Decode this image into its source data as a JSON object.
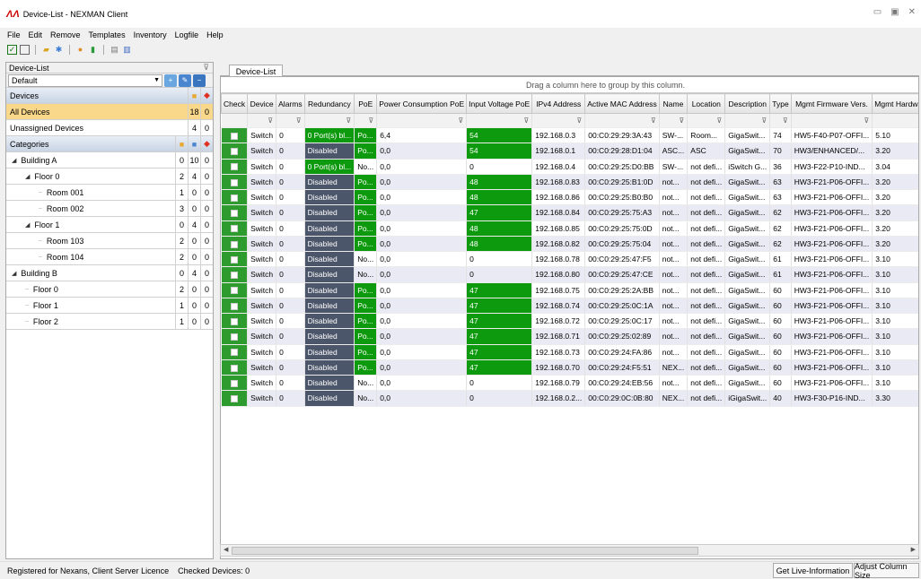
{
  "window": {
    "title": "Device-List - NEXMAN Client",
    "logo": "ɅɅ"
  },
  "menu": [
    "File",
    "Edit",
    "Remove",
    "Templates",
    "Inventory",
    "Logfile",
    "Help"
  ],
  "toolbar_icons": [
    "check-all-icon",
    "uncheck-icon",
    "folder-icon",
    "wand-icon",
    "user-icon",
    "database-icon",
    "template-icon",
    "template-edit-icon"
  ],
  "left": {
    "title": "Device-List",
    "pin": "⊽",
    "profile": "Default",
    "devices_header": "Devices",
    "device_rows": [
      {
        "name": "All Devices",
        "a": "18",
        "b": "0"
      },
      {
        "name": "Unassigned Devices",
        "a": "4",
        "b": "0"
      }
    ],
    "categories_header": "Categories",
    "tree": [
      {
        "name": "Building A",
        "lvl": 0,
        "exp": true,
        "a": "0",
        "b": "10",
        "c": "0"
      },
      {
        "name": "Floor 0",
        "lvl": 1,
        "exp": true,
        "a": "2",
        "b": "4",
        "c": "0"
      },
      {
        "name": "Room 001",
        "lvl": 2,
        "a": "1",
        "b": "0",
        "c": "0"
      },
      {
        "name": "Room 002",
        "lvl": 2,
        "a": "3",
        "b": "0",
        "c": "0"
      },
      {
        "name": "Floor 1",
        "lvl": 1,
        "exp": true,
        "a": "0",
        "b": "4",
        "c": "0"
      },
      {
        "name": "Room 103",
        "lvl": 2,
        "a": "2",
        "b": "0",
        "c": "0"
      },
      {
        "name": "Room 104",
        "lvl": 2,
        "a": "2",
        "b": "0",
        "c": "0"
      },
      {
        "name": "Building B",
        "lvl": 0,
        "exp": true,
        "a": "0",
        "b": "4",
        "c": "0"
      },
      {
        "name": "Floor 0",
        "lvl": 1,
        "a": "2",
        "b": "0",
        "c": "0"
      },
      {
        "name": "Floor 1",
        "lvl": 1,
        "a": "1",
        "b": "0",
        "c": "0"
      },
      {
        "name": "Floor 2",
        "lvl": 1,
        "a": "1",
        "b": "0",
        "c": "0"
      }
    ]
  },
  "tab": "Device-List",
  "group_hint": "Drag a column here to group by this column.",
  "columns": [
    "Check",
    "Device",
    "Alarms",
    "Redundancy",
    "PoE",
    "Power Consumption PoE",
    "Input Voltage PoE",
    "IPv4 Address",
    "Active MAC Address",
    "Name",
    "Location",
    "Description",
    "Type",
    "Mgmt Firmware Vers.",
    "Mgmt Hardware Vers."
  ],
  "rows": [
    [
      "",
      "Switch",
      "0",
      "0 Port(s) bl...",
      "Po...",
      "6,4",
      "54",
      "192.168.0.3",
      "00:C0:29:29:3A:43",
      "SW-...",
      "Room...",
      "GigaSwit...",
      "74",
      "HW5-F40-P07-OFFI...",
      "5.10"
    ],
    [
      "",
      "Switch",
      "0",
      "Disabled",
      "Po...",
      "0,0",
      "54",
      "192.168.0.1",
      "00:C0:29:28:D1:04",
      "ASC...",
      "ASC",
      "GigaSwit...",
      "70",
      "HW3/ENHANCED/...",
      "3.20"
    ],
    [
      "",
      "Switch",
      "0",
      "0 Port(s) bl...",
      "No...",
      "0,0",
      "0",
      "192.168.0.4",
      "00:C0:29:25:D0:BB",
      "SW-...",
      "not defi...",
      "iSwitch G...",
      "36",
      "HW3-F22-P10-IND...",
      "3.04"
    ],
    [
      "",
      "Switch",
      "0",
      "Disabled",
      "Po...",
      "0,0",
      "48",
      "192.168.0.83",
      "00:C0:29:25:B1:0D",
      "not...",
      "not defi...",
      "GigaSwit...",
      "63",
      "HW3-F21-P06-OFFI...",
      "3.20"
    ],
    [
      "",
      "Switch",
      "0",
      "Disabled",
      "Po...",
      "0,0",
      "48",
      "192.168.0.86",
      "00:C0:29:25:B0:B0",
      "not...",
      "not defi...",
      "GigaSwit...",
      "63",
      "HW3-F21-P06-OFFI...",
      "3.20"
    ],
    [
      "",
      "Switch",
      "0",
      "Disabled",
      "Po...",
      "0,0",
      "47",
      "192.168.0.84",
      "00:C0:29:25:75:A3",
      "not...",
      "not defi...",
      "GigaSwit...",
      "62",
      "HW3-F21-P06-OFFI...",
      "3.20"
    ],
    [
      "",
      "Switch",
      "0",
      "Disabled",
      "Po...",
      "0,0",
      "48",
      "192.168.0.85",
      "00:C0:29:25:75:0D",
      "not...",
      "not defi...",
      "GigaSwit...",
      "62",
      "HW3-F21-P06-OFFI...",
      "3.20"
    ],
    [
      "",
      "Switch",
      "0",
      "Disabled",
      "Po...",
      "0,0",
      "48",
      "192.168.0.82",
      "00:C0:29:25:75:04",
      "not...",
      "not defi...",
      "GigaSwit...",
      "62",
      "HW3-F21-P06-OFFI...",
      "3.20"
    ],
    [
      "",
      "Switch",
      "0",
      "Disabled",
      "No...",
      "0,0",
      "0",
      "192.168.0.78",
      "00:C0:29:25:47:F5",
      "not...",
      "not defi...",
      "GigaSwit...",
      "61",
      "HW3-F21-P06-OFFI...",
      "3.10"
    ],
    [
      "",
      "Switch",
      "0",
      "Disabled",
      "No...",
      "0,0",
      "0",
      "192.168.0.80",
      "00:C0:29:25:47:CE",
      "not...",
      "not defi...",
      "GigaSwit...",
      "61",
      "HW3-F21-P06-OFFI...",
      "3.10"
    ],
    [
      "",
      "Switch",
      "0",
      "Disabled",
      "Po...",
      "0,0",
      "47",
      "192.168.0.75",
      "00:C0:29:25:2A:BB",
      "not...",
      "not defi...",
      "GigaSwit...",
      "60",
      "HW3-F21-P06-OFFI...",
      "3.10"
    ],
    [
      "",
      "Switch",
      "0",
      "Disabled",
      "Po...",
      "0,0",
      "47",
      "192.168.0.74",
      "00:C0:29:25:0C:1A",
      "not...",
      "not defi...",
      "GigaSwit...",
      "60",
      "HW3-F21-P06-OFFI...",
      "3.10"
    ],
    [
      "",
      "Switch",
      "0",
      "Disabled",
      "Po...",
      "0,0",
      "47",
      "192.168.0.72",
      "00:C0:29:25:0C:17",
      "not...",
      "not defi...",
      "GigaSwit...",
      "60",
      "HW3-F21-P06-OFFI...",
      "3.10"
    ],
    [
      "",
      "Switch",
      "0",
      "Disabled",
      "Po...",
      "0,0",
      "47",
      "192.168.0.71",
      "00:C0:29:25:02:89",
      "not...",
      "not defi...",
      "GigaSwit...",
      "60",
      "HW3-F21-P06-OFFI...",
      "3.10"
    ],
    [
      "",
      "Switch",
      "0",
      "Disabled",
      "Po...",
      "0,0",
      "47",
      "192.168.0.73",
      "00:C0:29:24:FA:86",
      "not...",
      "not defi...",
      "GigaSwit...",
      "60",
      "HW3-F21-P06-OFFI...",
      "3.10"
    ],
    [
      "",
      "Switch",
      "0",
      "Disabled",
      "Po...",
      "0,0",
      "47",
      "192.168.0.70",
      "00:C0:29:24:F5:51",
      "NEX...",
      "not defi...",
      "GigaSwit...",
      "60",
      "HW3-F21-P06-OFFI...",
      "3.10"
    ],
    [
      "",
      "Switch",
      "0",
      "Disabled",
      "No...",
      "0,0",
      "0",
      "192.168.0.79",
      "00:C0:29:24:EB:56",
      "not...",
      "not defi...",
      "GigaSwit...",
      "60",
      "HW3-F21-P06-OFFI...",
      "3.10"
    ],
    [
      "",
      "Switch",
      "0",
      "Disabled",
      "No...",
      "0,0",
      "0",
      "192.168.0.2...",
      "00:C0:29:0C:0B:80",
      "NEX...",
      "not defi...",
      "iGigaSwit...",
      "40",
      "HW3-F30-P16-IND...",
      "3.30"
    ]
  ],
  "status": {
    "text": "Registered for Nexans, Client Server Licence    Checked Devices: 0",
    "btn_live": "Get Live-Information",
    "btn_adjust": "Adjust Column Size"
  },
  "colors": {
    "green": "#0e9a0e",
    "dark": "#4c566a",
    "selected": "#f9d88b",
    "alarm": "#e03020"
  }
}
